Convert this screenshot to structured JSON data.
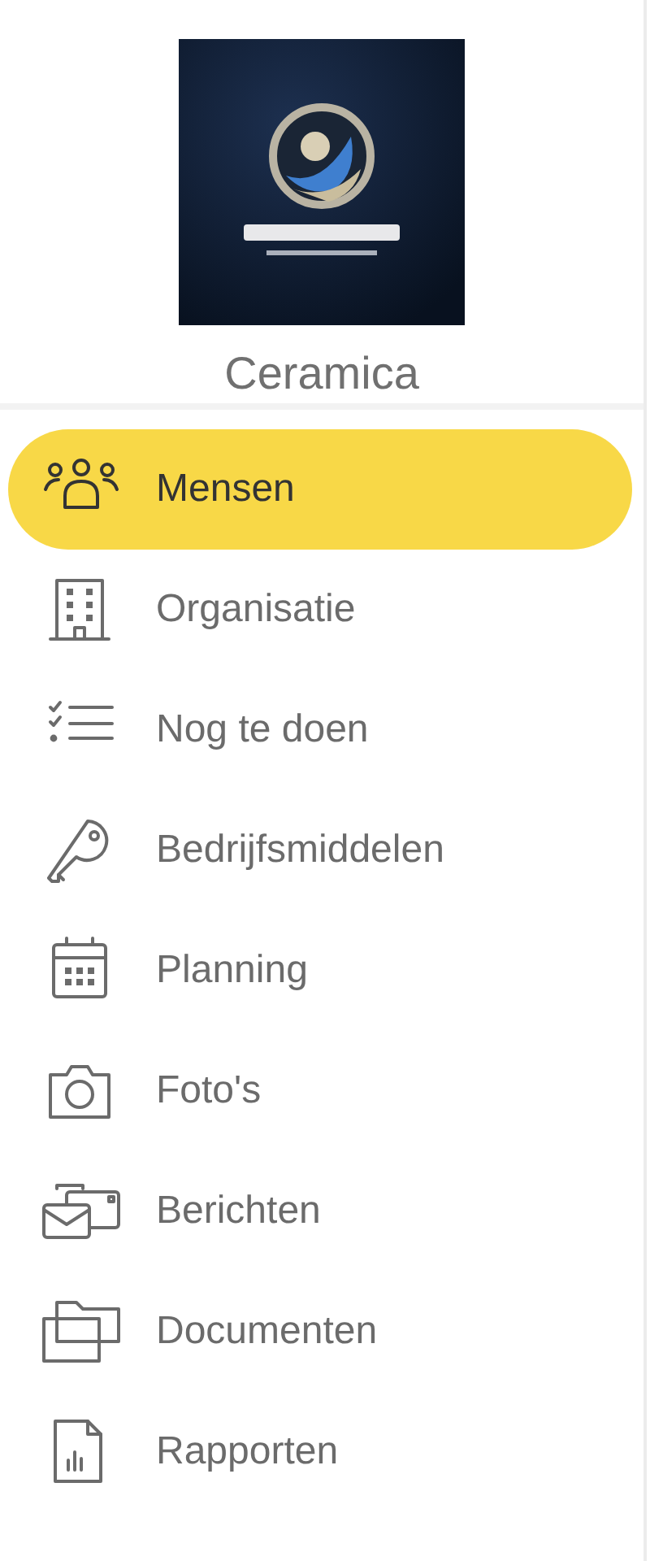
{
  "organization": {
    "name": "Ceramica"
  },
  "nav": [
    {
      "label": "Mensen",
      "selected": true
    },
    {
      "label": "Organisatie",
      "selected": false
    },
    {
      "label": "Nog te doen",
      "selected": false
    },
    {
      "label": "Bedrijfsmiddelen",
      "selected": false
    },
    {
      "label": "Planning",
      "selected": false
    },
    {
      "label": "Foto's",
      "selected": false
    },
    {
      "label": "Berichten",
      "selected": false
    },
    {
      "label": "Documenten",
      "selected": false
    },
    {
      "label": "Rapporten",
      "selected": false
    }
  ]
}
